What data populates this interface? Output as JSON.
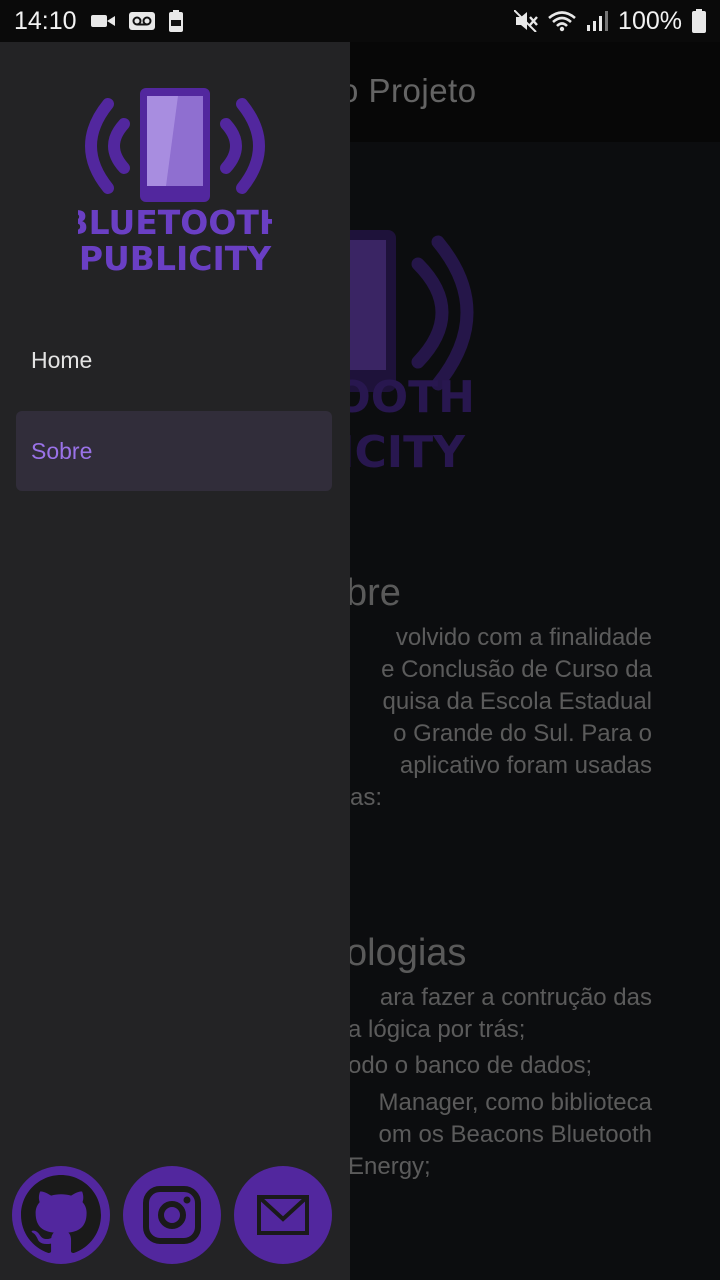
{
  "status_bar": {
    "time": "14:10",
    "battery_percent": "100%",
    "left_icons": [
      "video-icon",
      "voicemail-icon",
      "battery-saver-icon"
    ],
    "right_icons": [
      "mute-icon",
      "wifi-icon",
      "signal-icon",
      "battery-icon"
    ]
  },
  "app_bar": {
    "title": "o Projeto"
  },
  "logo": {
    "line1": "BLUETOOTH",
    "line2": "PUBLICITY",
    "bg_line1": "TOOTH",
    "bg_line2": "LICITY"
  },
  "drawer": {
    "items": [
      {
        "label": "Home",
        "selected": false
      },
      {
        "label": "Sobre",
        "selected": true
      }
    ],
    "social": [
      {
        "icon": "github-icon"
      },
      {
        "icon": "instagram-icon"
      },
      {
        "icon": "mail-icon"
      }
    ]
  },
  "content": {
    "sobre_heading": "bre",
    "sobre_lines": [
      "volvido com a finalidade",
      "e Conclusão de Curso da",
      "quisa da Escola Estadual",
      "o Grande do Sul. Para o",
      "aplicativo foram usadas",
      "as:"
    ],
    "tech_heading": "ologias",
    "tech_bullets": [
      [
        "ara fazer a contrução das",
        "a lógica por trás;"
      ],
      [
        "odo o banco de dados;"
      ],
      [
        "Manager, como biblioteca",
        "om os Beacons Bluetooth",
        "Energy;"
      ]
    ]
  },
  "colors": {
    "accent": "#9a72e8",
    "brand_purple": "#52279e",
    "drawer_bg": "#232325",
    "page_bg": "#131417"
  }
}
